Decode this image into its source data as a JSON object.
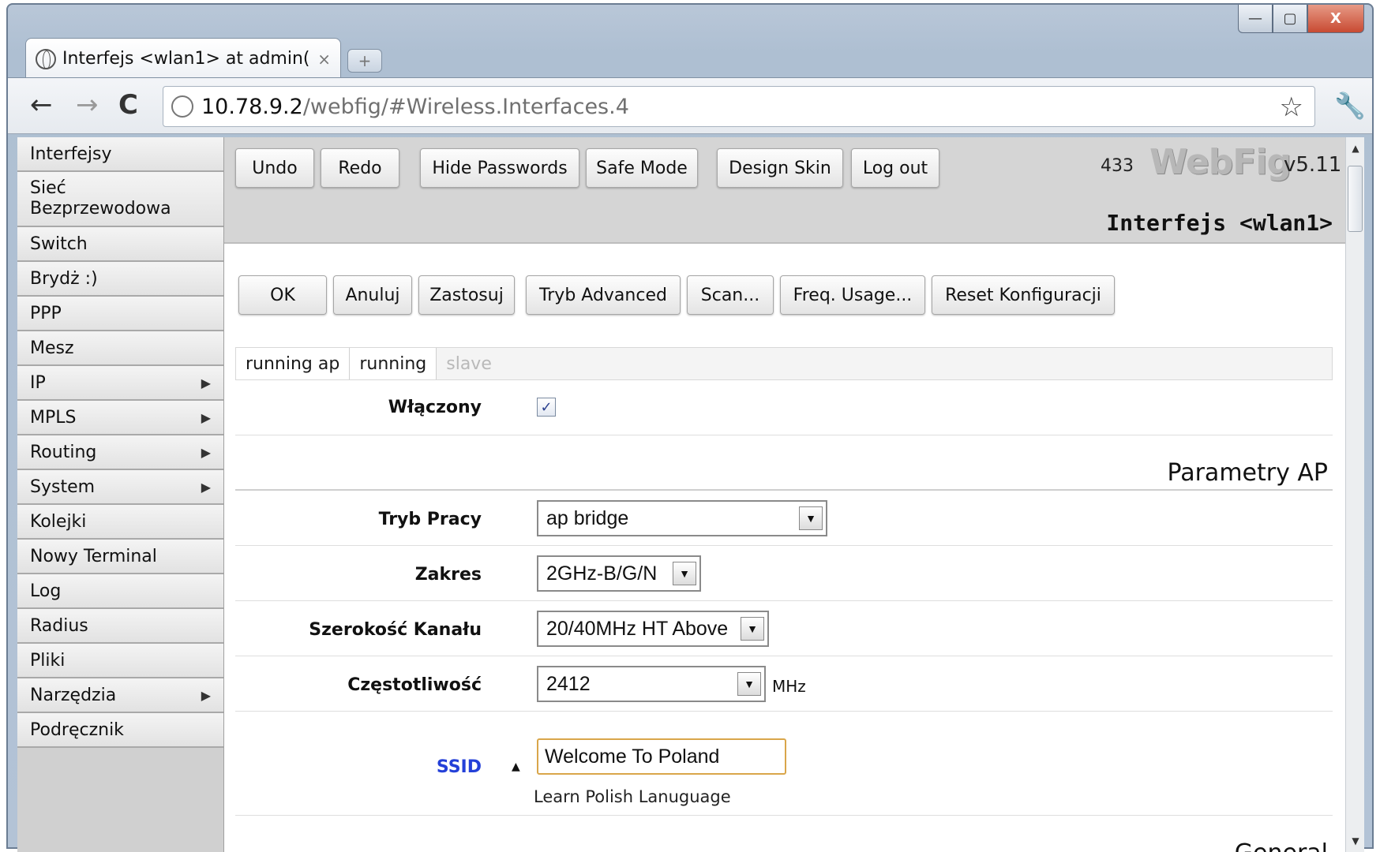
{
  "browser": {
    "tab_title": "Interfejs <wlan1> at admin(",
    "tab_close": "×",
    "new_tab": "+",
    "url_host": "10.78.9.2",
    "url_path": "/webfig/#Wireless.Interfaces.4",
    "window_controls": [
      "—",
      "▢",
      "X"
    ]
  },
  "sidebar": {
    "items": [
      {
        "label": "Interfejsy",
        "submenu": false
      },
      {
        "label": "Sieć Bezprzewodowa",
        "submenu": false
      },
      {
        "label": "Switch",
        "submenu": false
      },
      {
        "label": "Brydż :)",
        "submenu": false
      },
      {
        "label": "PPP",
        "submenu": false
      },
      {
        "label": "Mesz",
        "submenu": false
      },
      {
        "label": "IP",
        "submenu": true
      },
      {
        "label": "MPLS",
        "submenu": true
      },
      {
        "label": "Routing",
        "submenu": true
      },
      {
        "label": "System",
        "submenu": true
      },
      {
        "label": "Kolejki",
        "submenu": false
      },
      {
        "label": "Nowy Terminal",
        "submenu": false
      },
      {
        "label": "Log",
        "submenu": false
      },
      {
        "label": "Radius",
        "submenu": false
      },
      {
        "label": "Pliki",
        "submenu": false
      },
      {
        "label": "Narzędzia",
        "submenu": true
      },
      {
        "label": "Podręcznik",
        "submenu": false
      }
    ],
    "submenu_arrow": "▶"
  },
  "topbar": {
    "buttons": {
      "undo": "Undo",
      "redo": "Redo",
      "hide_passwords": "Hide Passwords",
      "safe_mode": "Safe Mode",
      "design_skin": "Design Skin",
      "log_out": "Log out"
    },
    "counter": "433",
    "logo": "WebFig",
    "version": "v5.11",
    "page_title": "Interfejs <wlan1>"
  },
  "actions": {
    "ok": "OK",
    "cancel": "Anuluj",
    "apply": "Zastosuj",
    "advanced": "Tryb Advanced",
    "scan": "Scan...",
    "freq_usage": "Freq. Usage...",
    "reset": "Reset Konfiguracji"
  },
  "status": [
    "running ap",
    "running",
    "slave"
  ],
  "form": {
    "enabled_label": "Włączony",
    "enabled_checked": true,
    "section_ap": "Parametry AP",
    "mode_label": "Tryb Pracy",
    "mode_value": "ap bridge",
    "band_label": "Zakres",
    "band_value": "2GHz-B/G/N",
    "width_label": "Szerokość Kanału",
    "width_value": "20/40MHz HT Above",
    "freq_label": "Częstotliwość",
    "freq_value": "2412",
    "freq_unit": "MHz",
    "ssid_label": "SSID",
    "ssid_value": "Welcome To Poland",
    "ssid_hint": "Learn Polish Lanuguage",
    "section_general": "General"
  }
}
